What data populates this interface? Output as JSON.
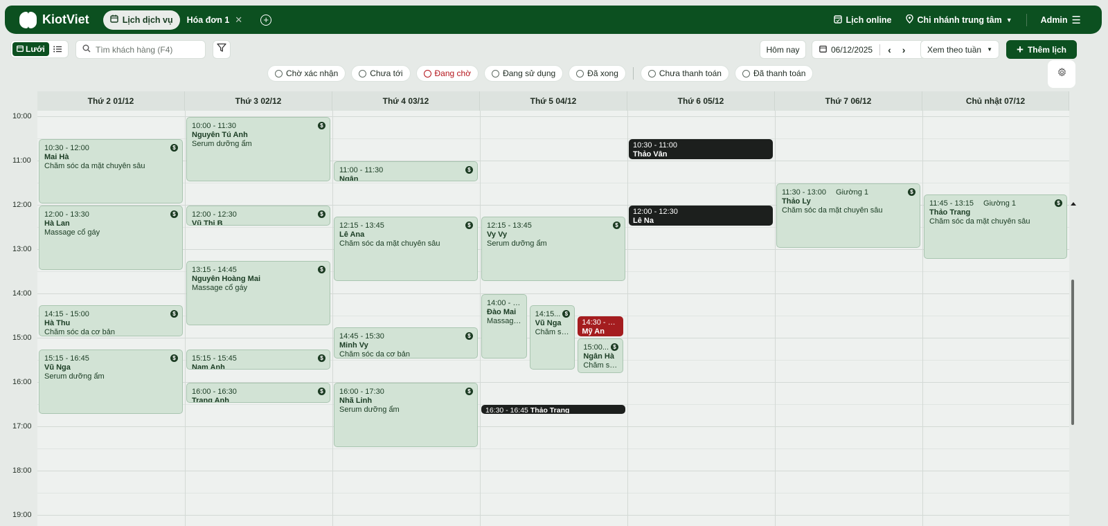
{
  "header": {
    "brand": "KiotViet",
    "tabs": [
      {
        "label": "Lịch dịch vụ",
        "active": true
      },
      {
        "label": "Hóa đơn 1",
        "active": false
      }
    ],
    "online_label": "Lịch online",
    "branch": "Chi nhánh trung tâm",
    "user": "Admin"
  },
  "toolbar": {
    "grid_label": "Lưới",
    "search_placeholder": "Tìm khách hàng (F4)",
    "today": "Hôm nay",
    "date": "06/12/2025",
    "view_mode": "Xem theo tuần",
    "add_label": "Thêm lịch"
  },
  "status_filters": [
    {
      "label": "Chờ xác nhận",
      "color": "#5f6b63"
    },
    {
      "label": "Chưa tới",
      "color": "#5f6b63"
    },
    {
      "label": "Đang chờ",
      "color": "#b4141b"
    },
    {
      "label": "Đang sử dụng",
      "color": "#5f6b63"
    },
    {
      "label": "Đã xong",
      "color": "#5f6b63"
    },
    {
      "label": "Chưa thanh toán",
      "color": "#5f6b63"
    },
    {
      "label": "Đã thanh toán",
      "color": "#5f6b63"
    }
  ],
  "days": [
    "Thứ 2 01/12",
    "Thứ 3 02/12",
    "Thứ 4 03/12",
    "Thứ 5 04/12",
    "Thứ 6 05/12",
    "Thứ 7 06/12",
    "Chủ nhật 07/12"
  ],
  "hours": [
    "10:00",
    "11:00",
    "12:00",
    "13:00",
    "14:00",
    "15:00",
    "16:00",
    "17:00",
    "18:00",
    "19:00"
  ],
  "events": [
    {
      "day": 0,
      "time": "10:30 - 12:00",
      "name": "Mai Hà",
      "service": "Chăm sóc da mặt chuyên sâu",
      "paid": true
    },
    {
      "day": 0,
      "time": "12:00 - 13:30",
      "name": "Hà Lan",
      "service": "Massage cổ gáy",
      "paid": true
    },
    {
      "day": 0,
      "time": "14:15 - 15:00",
      "name": "Hà Thu",
      "service": "Chăm sóc da cơ bản",
      "paid": true
    },
    {
      "day": 0,
      "time": "15:15 - 16:45",
      "name": "Vũ Nga",
      "service": "Serum dưỡng ẩm",
      "paid": true
    },
    {
      "day": 1,
      "time": "10:00 - 11:30",
      "name": "Nguyên Tú Anh",
      "service": "Serum dưỡng ẩm",
      "paid": true
    },
    {
      "day": 1,
      "time": "12:00 - 12:30",
      "name": "Vũ Thị B",
      "service": "",
      "paid": true
    },
    {
      "day": 1,
      "time": "13:15 - 14:45",
      "name": "Nguyên Hoàng Mai",
      "service": "Massage cổ gáy",
      "paid": true
    },
    {
      "day": 1,
      "time": "15:15 - 15:45",
      "name": "Nam Anh",
      "service": "",
      "paid": true
    },
    {
      "day": 1,
      "time": "16:00 - 16:30",
      "name": "Trang Anh",
      "service": "",
      "paid": true
    },
    {
      "day": 2,
      "time": "11:00 - 11:30",
      "name": "Ngân",
      "service": "",
      "paid": true
    },
    {
      "day": 2,
      "time": "12:15 - 13:45",
      "name": "Lê Ana",
      "service": "Chăm sóc da mặt chuyên sâu",
      "paid": true
    },
    {
      "day": 2,
      "time": "14:45 - 15:30",
      "name": "Minh Vy",
      "service": "Chăm sóc da cơ bản",
      "paid": true
    },
    {
      "day": 2,
      "time": "16:00 - 17:30",
      "name": "Nhã Linh",
      "service": "Serum dưỡng ẩm",
      "paid": true
    },
    {
      "day": 3,
      "time": "12:15 - 13:45",
      "name": "Vy Vy",
      "service": "Serum dưỡng ẩm",
      "paid": true
    },
    {
      "day": 3,
      "time": "14:00 - 1...",
      "name": "Đào Mai",
      "service": "Massage...",
      "paid": false
    },
    {
      "day": 3,
      "time": "14:15...",
      "name": "Vũ Nga",
      "service": "Chăm só...",
      "paid": true
    },
    {
      "day": 3,
      "time": "14:30 - 15...",
      "name": "Mỹ An",
      "service": "",
      "paid": false,
      "status": "red"
    },
    {
      "day": 3,
      "time": "15:00...",
      "name": "Ngân Hà",
      "service": "Chăm só...",
      "paid": true
    },
    {
      "day": 3,
      "time": "16:30 - 16:45",
      "name": "Thảo Trang",
      "service": "",
      "paid": false,
      "status": "dark"
    },
    {
      "day": 4,
      "time": "10:30 - 11:00",
      "name": "Thảo Vân",
      "service": "",
      "paid": false,
      "status": "dark"
    },
    {
      "day": 4,
      "time": "12:00 - 12:30",
      "name": "Lê Na",
      "service": "",
      "paid": false,
      "status": "dark"
    },
    {
      "day": 5,
      "time": "11:30 - 13:00",
      "bed": "Giường 1",
      "name": "Thảo Ly",
      "service": "Chăm sóc da mặt chuyên sâu",
      "paid": true
    },
    {
      "day": 6,
      "time": "11:45 - 13:15",
      "bed": "Giường 1",
      "name": "Thảo Trang",
      "service": "Chăm sóc da mặt chuyên sâu",
      "paid": true
    }
  ],
  "icons": {
    "calendar": "calendar-icon",
    "pin": "map-pin-icon",
    "menu": "hamburger-icon",
    "search": "search-icon",
    "filter": "filter-icon",
    "gear": "gear-icon",
    "coin": "dollar-coin-icon"
  }
}
